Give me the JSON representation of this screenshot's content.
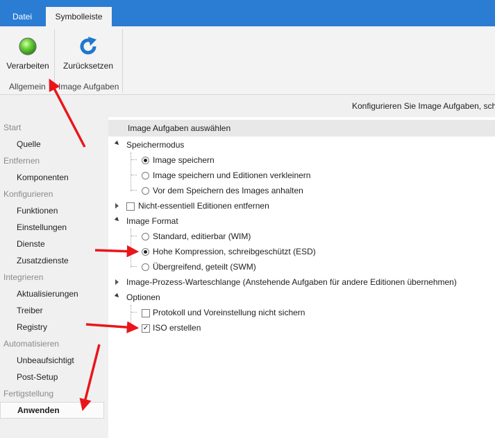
{
  "ribbon": {
    "tabs": [
      {
        "label": "Datei"
      },
      {
        "label": "Symbolleiste"
      }
    ],
    "buttons": {
      "process": "Verarbeiten",
      "reset": "Zurücksetzen"
    },
    "groups": {
      "general": "Allgemein",
      "image_tasks": "Image Aufgaben"
    }
  },
  "infobar": {
    "text": "Konfigurieren Sie Image Aufgaben, sch"
  },
  "sidebar": {
    "start": "Start",
    "source": "Quelle",
    "remove": "Entfernen",
    "components": "Komponenten",
    "configure": "Konfigurieren",
    "functions": "Funktionen",
    "settings": "Einstellungen",
    "services": "Dienste",
    "extra_services": "Zusatzdienste",
    "integrate": "Integrieren",
    "updates": "Aktualisierungen",
    "drivers": "Treiber",
    "registry": "Registry",
    "automate": "Automatisieren",
    "unattended": "Unbeaufsichtigt",
    "post_setup": "Post-Setup",
    "finish": "Fertigstellung",
    "apply": "Anwenden"
  },
  "main": {
    "header": "Image Aufgaben auswählen",
    "save_mode": "Speichermodus",
    "save_image": "Image speichern",
    "save_trim": "Image speichern und Editionen verkleinern",
    "stop_before": "Vor dem Speichern des Images anhalten",
    "remove_nonessential": "Nicht-essentiell Editionen entfernen",
    "image_format": "Image Format",
    "fmt_wim": "Standard, editierbar (WIM)",
    "fmt_esd": "Hohe Kompression, schreibgeschützt (ESD)",
    "fmt_swm": "Übergreifend, geteilt (SWM)",
    "queue": "Image-Prozess-Warteschlange (Anstehende Aufgaben für andere Editionen übernehmen)",
    "options": "Optionen",
    "no_log": "Protokoll und Voreinstellung nicht sichern",
    "create_iso": "ISO erstellen"
  },
  "state": {
    "save_mode_selected": "Image speichern",
    "format_selected": "Hohe Kompression, schreibgeschützt (ESD)",
    "remove_nonessential_checked": false,
    "no_log_checked": false,
    "create_iso_checked": true
  },
  "colors": {
    "ribbon_blue": "#2b7cd3",
    "annotation_red": "#e8161b",
    "sidebar_bg": "#f0f0f0"
  }
}
